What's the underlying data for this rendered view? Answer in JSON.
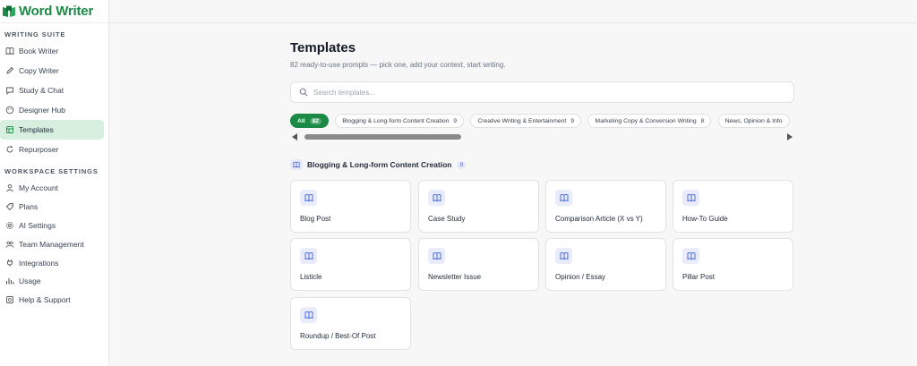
{
  "brand": {
    "name": "Word Writer"
  },
  "sidebar": {
    "suite_title": "WRITING SUITE",
    "suite_items": [
      {
        "label": "Book Writer",
        "icon": "book-icon"
      },
      {
        "label": "Copy Writer",
        "icon": "pen-icon"
      },
      {
        "label": "Study & Chat",
        "icon": "chat-icon"
      },
      {
        "label": "Designer Hub",
        "icon": "palette-icon"
      },
      {
        "label": "Templates",
        "icon": "template-icon",
        "active": true
      },
      {
        "label": "Repurposer",
        "icon": "refresh-icon"
      }
    ],
    "settings_title": "WORKSPACE SETTINGS",
    "settings_items": [
      {
        "label": "My Account",
        "icon": "user-icon"
      },
      {
        "label": "Plans",
        "icon": "tag-icon"
      },
      {
        "label": "AI Settings",
        "icon": "gear-icon"
      },
      {
        "label": "Team Management",
        "icon": "team-icon"
      },
      {
        "label": "Integrations",
        "icon": "plug-icon"
      },
      {
        "label": "Usage",
        "icon": "chart-icon"
      },
      {
        "label": "Help & Support",
        "icon": "help-icon"
      }
    ]
  },
  "main": {
    "title": "Templates",
    "subtitle": "82 ready-to-use prompts — pick one, add your context, start writing.",
    "search_placeholder": "Search templates...",
    "chips": [
      {
        "label": "All",
        "count": "82",
        "active": true
      },
      {
        "label": "Blogging & Long-form Content Creation",
        "count": "9"
      },
      {
        "label": "Creative Writing & Entertainment",
        "count": "9"
      },
      {
        "label": "Marketing Copy & Conversion Writing",
        "count": "8"
      },
      {
        "label": "News, Opinion & Info",
        "count": ""
      }
    ],
    "category": {
      "label": "Blogging & Long-form Content Creation",
      "count": "9"
    },
    "cards": [
      "Blog Post",
      "Case Study",
      "Comparison Article (X vs Y)",
      "How-To Guide",
      "Listicle",
      "Newsletter Issue",
      "Opinion / Essay",
      "Pillar Post",
      "Roundup / Best-Of Post"
    ]
  },
  "colors": {
    "brand": "#1a8a45",
    "active_nav": "#d7efdf",
    "icon_bg": "#e8ecfb",
    "icon_fg": "#4f6bd8"
  }
}
